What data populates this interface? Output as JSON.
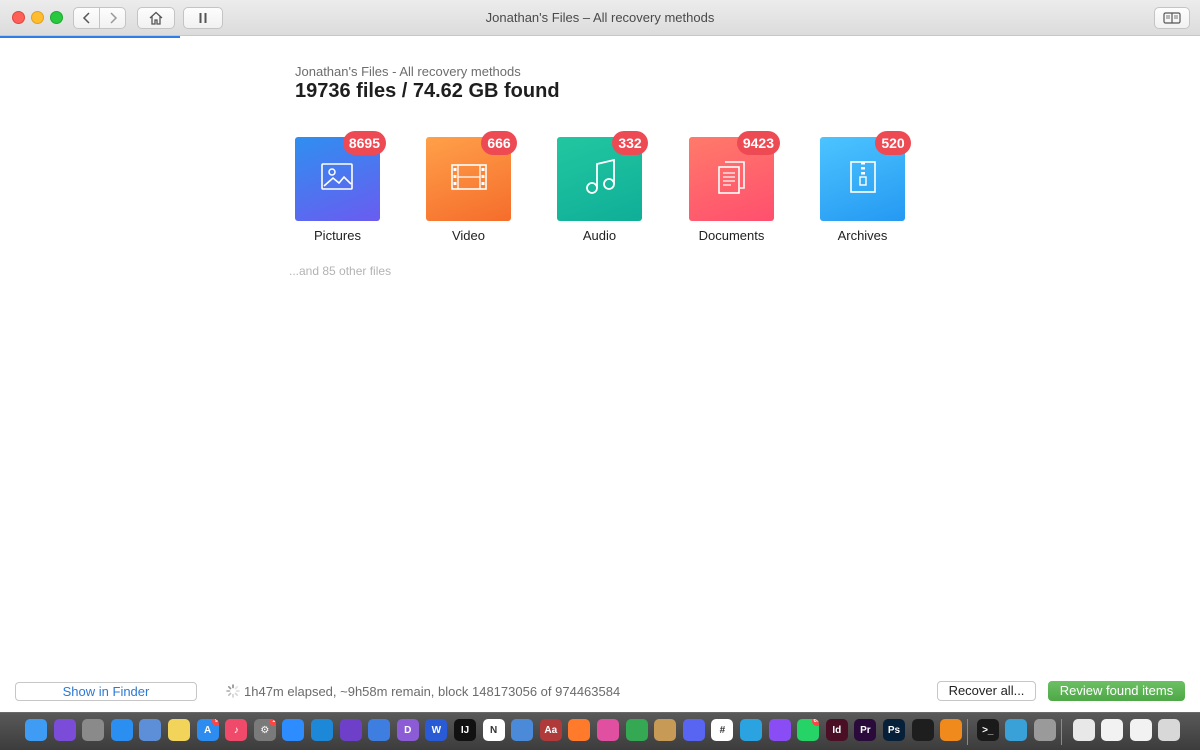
{
  "window": {
    "title": "Jonathan's Files – All recovery methods",
    "scan_progress_fraction": 0.15
  },
  "summary": {
    "subtitle": "Jonathan's Files - All recovery methods",
    "headline": "19736 files / 74.62 GB found",
    "other_files": "...and 85 other files"
  },
  "categories": [
    {
      "label": "Pictures",
      "count": "8695",
      "icon": "picture-icon",
      "color_top": "#2f8ff0",
      "color_bottom": "#6a5cf0"
    },
    {
      "label": "Video",
      "count": "666",
      "icon": "film-icon",
      "color_top": "#ffa04a",
      "color_bottom": "#f56d2b"
    },
    {
      "label": "Audio",
      "count": "332",
      "icon": "music-note-icon",
      "color_top": "#22c7a0",
      "color_bottom": "#0fae98"
    },
    {
      "label": "Documents",
      "count": "9423",
      "icon": "documents-icon",
      "color_top": "#ff7a6a",
      "color_bottom": "#ff4f6e"
    },
    {
      "label": "Archives",
      "count": "520",
      "icon": "zip-archive-icon",
      "color_top": "#4cc4ff",
      "color_bottom": "#2599f2"
    }
  ],
  "footer": {
    "show_in_finder": "Show in Finder",
    "status": "1h47m elapsed, ~9h58m remain, block 148173056 of 974463584",
    "recover_all": "Recover all...",
    "review_found": "Review found items"
  },
  "dock": {
    "apps": [
      {
        "name": "finder-icon",
        "color": "#3f9cf5",
        "glyph": ""
      },
      {
        "name": "siri-icon",
        "color": "#7a4cd8",
        "glyph": ""
      },
      {
        "name": "launchpad-icon",
        "color": "#8a8a8a",
        "glyph": ""
      },
      {
        "name": "safari-icon",
        "color": "#2a8ff0",
        "glyph": ""
      },
      {
        "name": "preview-icon",
        "color": "#5d8fd8",
        "glyph": ""
      },
      {
        "name": "notes-icon",
        "color": "#f3d45a",
        "glyph": ""
      },
      {
        "name": "app-store-icon",
        "color": "#2d8cf0",
        "glyph": "A",
        "badge": "9"
      },
      {
        "name": "music-icon",
        "color": "#f04a6a",
        "glyph": "♪"
      },
      {
        "name": "system-preferences-icon",
        "color": "#7a7a7a",
        "glyph": "⚙",
        "badge": "1"
      },
      {
        "name": "zoom-icon",
        "color": "#2d8cff",
        "glyph": ""
      },
      {
        "name": "vscode-icon",
        "color": "#1e88d8",
        "glyph": ""
      },
      {
        "name": "github-icon",
        "color": "#6e40c9",
        "glyph": ""
      },
      {
        "name": "xcode-icon",
        "color": "#3e7ee0",
        "glyph": ""
      },
      {
        "name": "dash-icon",
        "color": "#8b5cd6",
        "glyph": "D"
      },
      {
        "name": "word-icon",
        "color": "#2a5bd7",
        "glyph": "W"
      },
      {
        "name": "intellij-icon",
        "color": "#111111",
        "glyph": "IJ"
      },
      {
        "name": "notion-icon",
        "color": "#ffffff",
        "glyph": "N"
      },
      {
        "name": "tool-icon",
        "color": "#4a8ad8",
        "glyph": ""
      },
      {
        "name": "dictionary-icon",
        "color": "#b03a3a",
        "glyph": "Aa"
      },
      {
        "name": "firefox-icon",
        "color": "#ff7a2a",
        "glyph": ""
      },
      {
        "name": "arc-icon",
        "color": "#e04fa0",
        "glyph": ""
      },
      {
        "name": "chrome-icon",
        "color": "#34a853",
        "glyph": ""
      },
      {
        "name": "maps-icon",
        "color": "#c79a55",
        "glyph": ""
      },
      {
        "name": "discord-icon",
        "color": "#5865f2",
        "glyph": ""
      },
      {
        "name": "slack-icon",
        "color": "#ffffff",
        "glyph": "#"
      },
      {
        "name": "telegram-icon",
        "color": "#2aa3e0",
        "glyph": ""
      },
      {
        "name": "messenger-icon",
        "color": "#8a4cf5",
        "glyph": ""
      },
      {
        "name": "whatsapp-icon",
        "color": "#25d366",
        "glyph": "",
        "badge": "60"
      },
      {
        "name": "indesign-icon",
        "color": "#4a0e25",
        "glyph": "Id"
      },
      {
        "name": "premiere-icon",
        "color": "#2a0a3a",
        "glyph": "Pr"
      },
      {
        "name": "photoshop-icon",
        "color": "#07203a",
        "glyph": "Ps"
      },
      {
        "name": "figma-icon",
        "color": "#1e1e1e",
        "glyph": ""
      },
      {
        "name": "vlc-icon",
        "color": "#f08a1c",
        "glyph": ""
      },
      {
        "name": "terminal-icon",
        "color": "#1a1a1a",
        "glyph": ">_"
      },
      {
        "name": "avatar-app-icon",
        "color": "#3aa0d8",
        "glyph": ""
      },
      {
        "name": "disk-drill-icon",
        "color": "#9a9a9a",
        "glyph": ""
      },
      {
        "name": "documents-stack-icon",
        "color": "#e8e8e8",
        "glyph": ""
      },
      {
        "name": "file-stack-icon",
        "color": "#f2f2f2",
        "glyph": ""
      },
      {
        "name": "file-stack-2-icon",
        "color": "#f2f2f2",
        "glyph": ""
      },
      {
        "name": "trash-icon",
        "color": "#d8d8d8",
        "glyph": ""
      }
    ]
  }
}
